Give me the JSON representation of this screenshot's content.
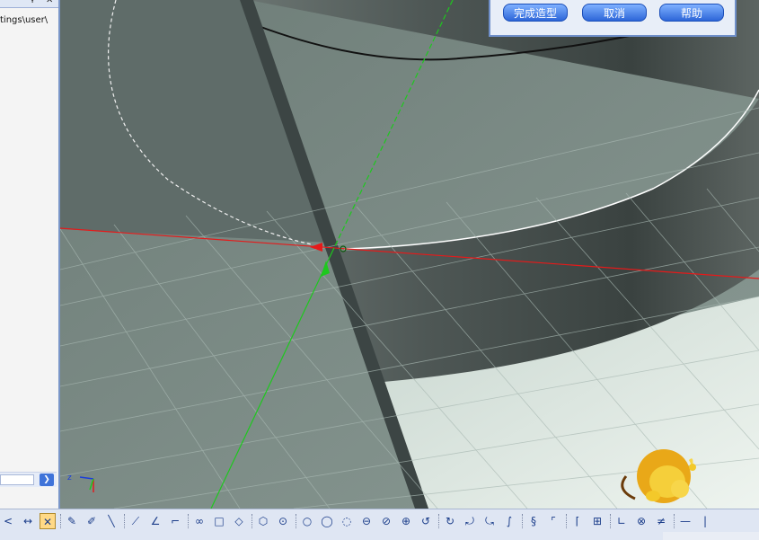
{
  "left_panel": {
    "title_glyphs": {
      "pin": "ᵼ",
      "close": "✕"
    },
    "path_text": "tings\\user\\",
    "scroll_arrow": "❯"
  },
  "dialog": {
    "finish_label": "完成造型",
    "cancel_label": "取消",
    "help_label": "帮助"
  },
  "axis_indicator": {
    "label": "z"
  },
  "toolbar": {
    "icons": [
      {
        "name": "arrow-left-icon",
        "glyph": "<"
      },
      {
        "name": "dimension-icon",
        "glyph": "↔"
      },
      {
        "name": "trim-cross-icon",
        "glyph": "✕"
      },
      {
        "name": "pencil-sketch-icon",
        "glyph": "✎"
      },
      {
        "name": "pencil-dim-icon",
        "glyph": "✐"
      },
      {
        "name": "line-icon",
        "glyph": "╲"
      },
      {
        "name": "tangent-line-icon",
        "glyph": "⟋"
      },
      {
        "name": "angle-line-icon",
        "glyph": "∠"
      },
      {
        "name": "polyline-icon",
        "glyph": "⌐"
      },
      {
        "name": "chain-icon",
        "glyph": "∞"
      },
      {
        "name": "rectangle-icon",
        "glyph": "□"
      },
      {
        "name": "diamond-icon",
        "glyph": "◇"
      },
      {
        "name": "hexagon-icon",
        "glyph": "⬡"
      },
      {
        "name": "circle-center-icon",
        "glyph": "⊙"
      },
      {
        "name": "circle-two-point-icon",
        "glyph": "○"
      },
      {
        "name": "circle-three-point-icon",
        "glyph": "◯"
      },
      {
        "name": "circle-tangent-icon",
        "glyph": "◌"
      },
      {
        "name": "circle-four-icon",
        "glyph": "⊖"
      },
      {
        "name": "circle-five-icon",
        "glyph": "⊘"
      },
      {
        "name": "ellipse-icon",
        "glyph": "⊕"
      },
      {
        "name": "arc-icon",
        "glyph": "↺"
      },
      {
        "name": "arc-two-icon",
        "glyph": "↻"
      },
      {
        "name": "arc-three-icon",
        "glyph": "⤾"
      },
      {
        "name": "arc-four-icon",
        "glyph": "⤿"
      },
      {
        "name": "spline-icon",
        "glyph": "∫"
      },
      {
        "name": "spline-two-icon",
        "glyph": "§"
      },
      {
        "name": "fillet-icon",
        "glyph": "⌜"
      },
      {
        "name": "chamfer-icon",
        "glyph": "⌈"
      },
      {
        "name": "measure-icon",
        "glyph": "⊞"
      },
      {
        "name": "corner-icon",
        "glyph": "∟"
      },
      {
        "name": "constraint-icon",
        "glyph": "⊗"
      },
      {
        "name": "equal-icon",
        "glyph": "≠"
      },
      {
        "name": "horizontal-icon",
        "glyph": "—"
      },
      {
        "name": "vertical-icon",
        "glyph": "|"
      }
    ]
  }
}
